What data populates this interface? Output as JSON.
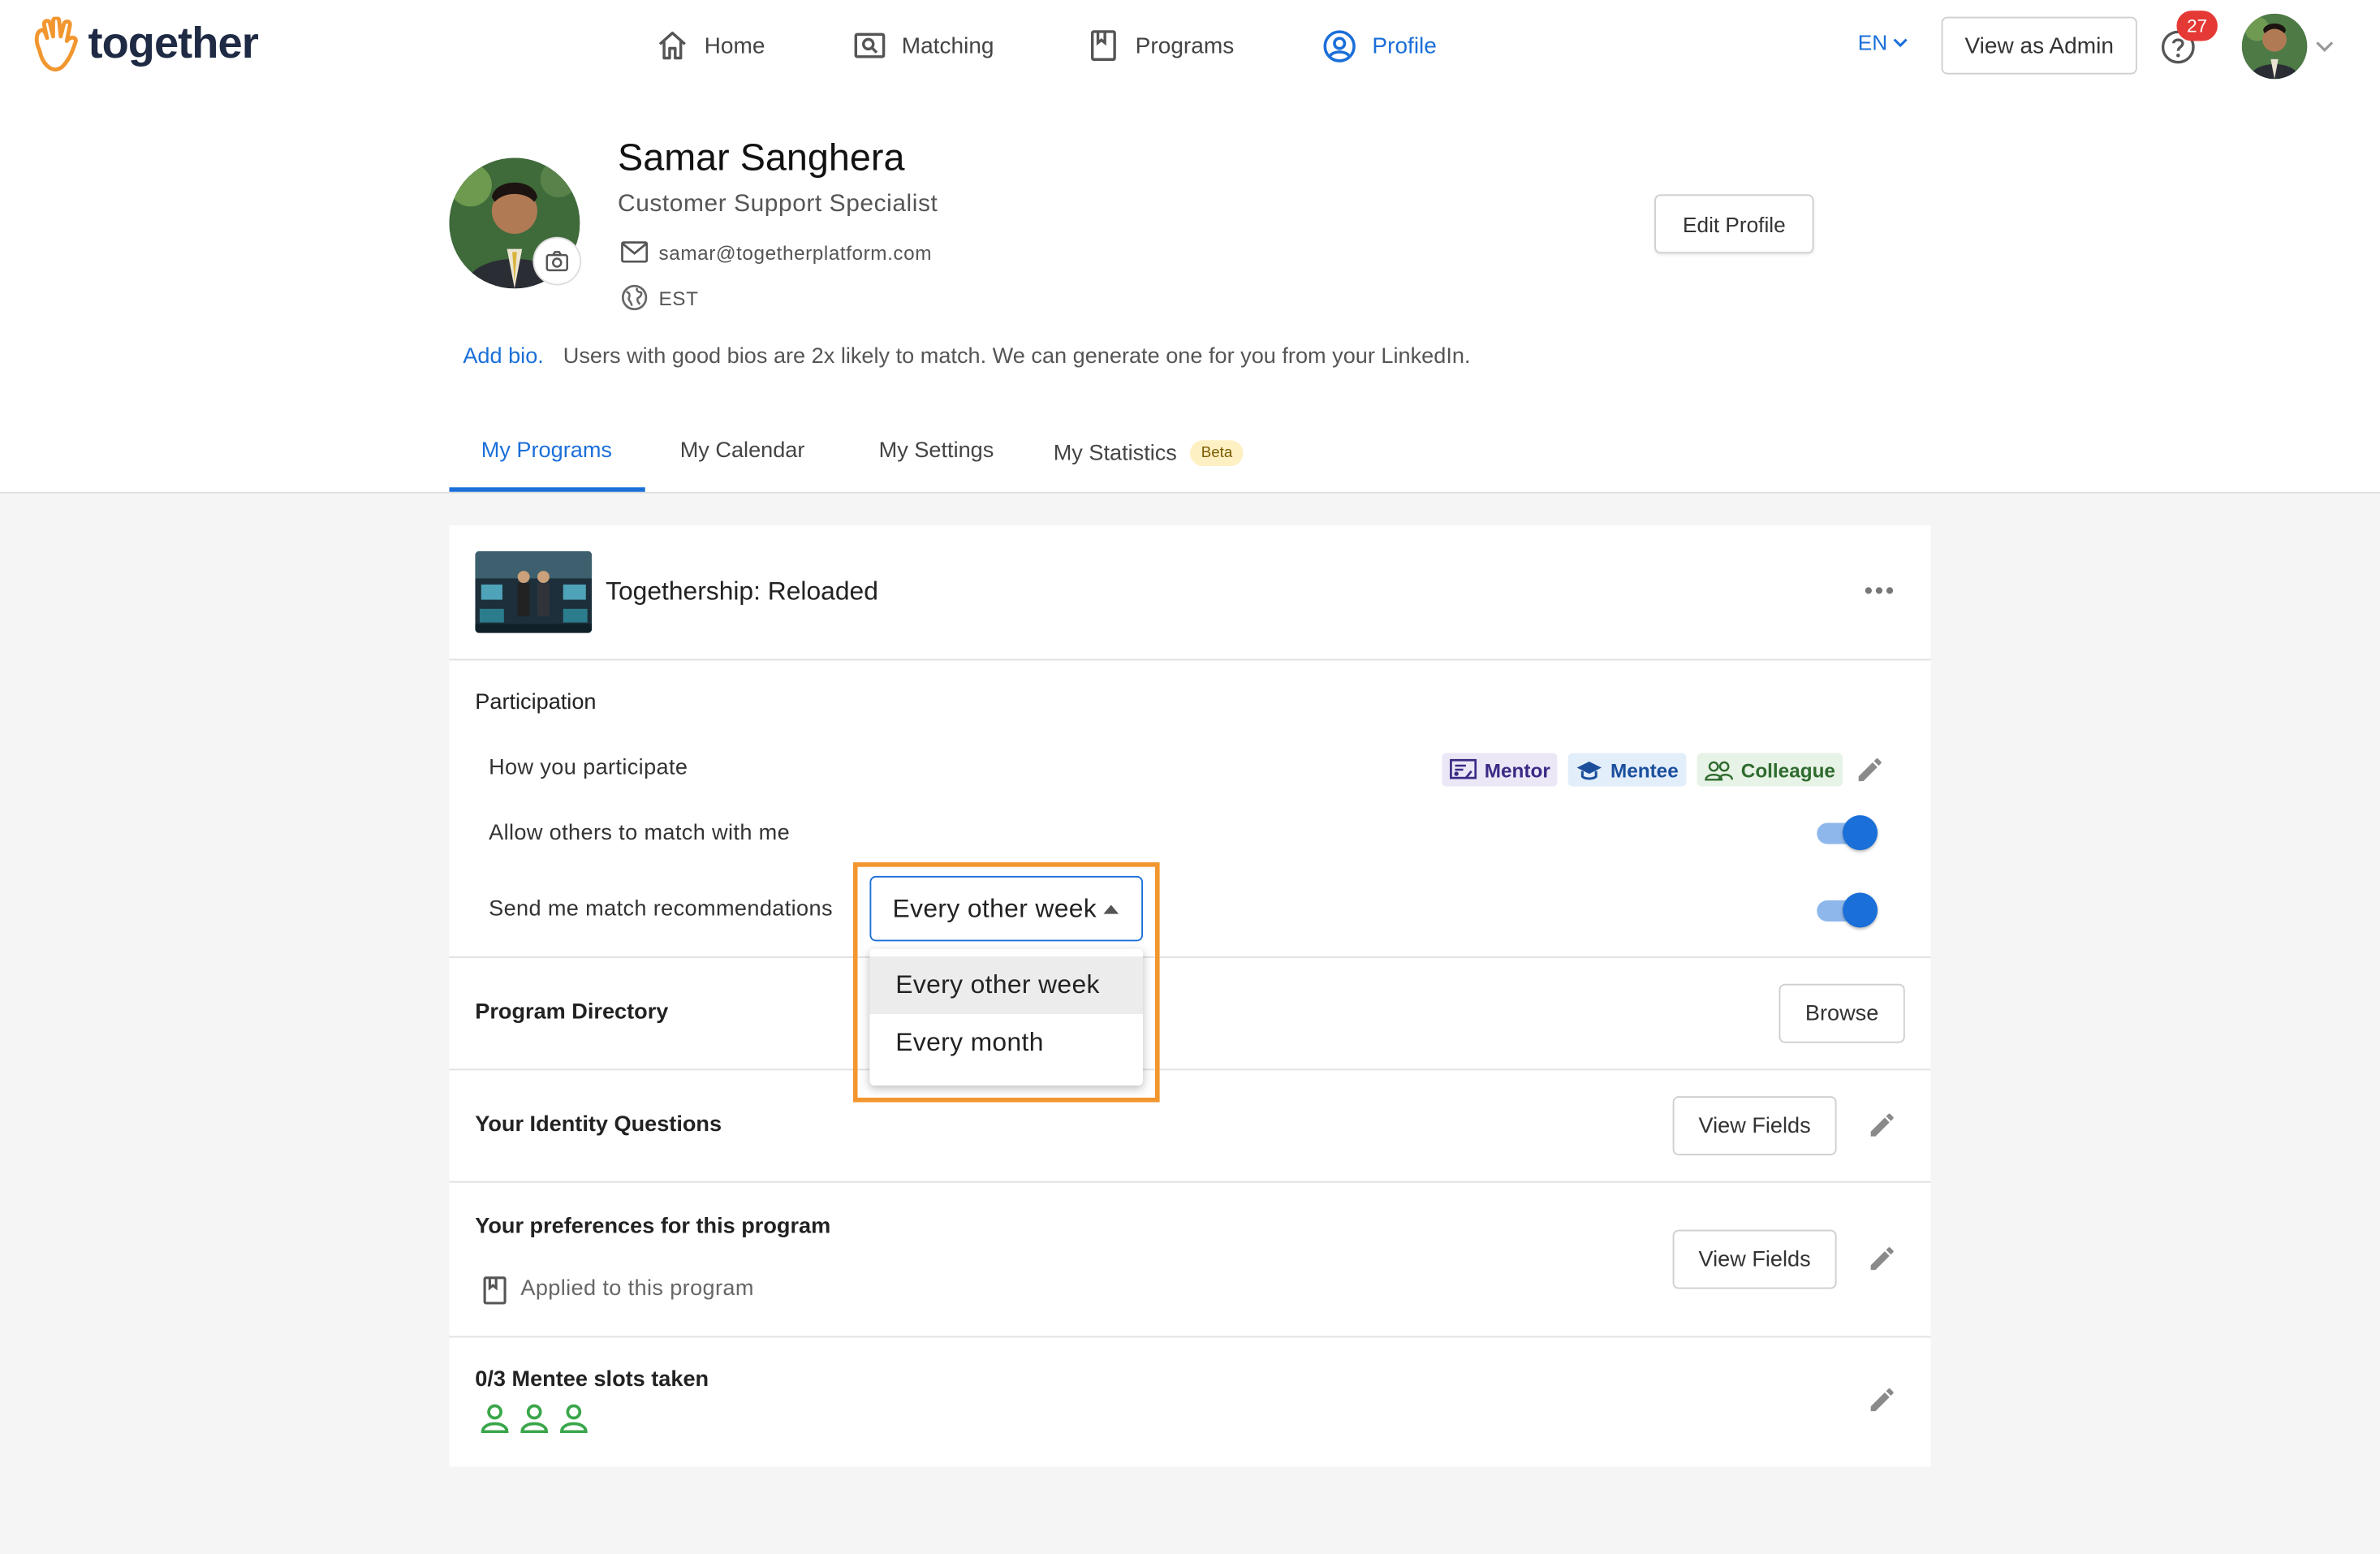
{
  "app": {
    "brand": "together"
  },
  "nav": {
    "items": [
      {
        "label": "Home",
        "icon": "home-icon"
      },
      {
        "label": "Matching",
        "icon": "matching-icon"
      },
      {
        "label": "Programs",
        "icon": "programs-icon"
      },
      {
        "label": "Profile",
        "icon": "profile-icon",
        "active": true
      }
    ],
    "language": "EN",
    "view_admin": "View as Admin",
    "notifications": "27"
  },
  "profile": {
    "name": "Samar Sanghera",
    "title": "Customer Support Specialist",
    "email": "samar@togetherplatform.com",
    "timezone": "EST",
    "edit_button": "Edit Profile",
    "bio_link": "Add bio.",
    "bio_hint": "Users with good bios are 2x likely to match. We can generate one for you from your LinkedIn."
  },
  "tabs": [
    {
      "label": "My Programs",
      "active": true
    },
    {
      "label": "My Calendar"
    },
    {
      "label": "My Settings"
    },
    {
      "label": "My Statistics",
      "badge": "Beta"
    }
  ],
  "program": {
    "name": "Togethership: Reloaded",
    "participation": {
      "heading": "Participation",
      "how_label": "How you participate",
      "roles": [
        "Mentor",
        "Mentee",
        "Colleague"
      ],
      "allow_label": "Allow others to match with me",
      "allow_on": true,
      "recommend_label": "Send me match recommendations",
      "recommend_on": true,
      "frequency": {
        "selected": "Every other week",
        "options": [
          "Every other week",
          "Every month"
        ]
      }
    },
    "directory": {
      "label": "Program Directory",
      "button": "Browse"
    },
    "identity": {
      "label": "Your Identity Questions",
      "button": "View Fields"
    },
    "preferences": {
      "label": "Your preferences for this program",
      "button": "View Fields",
      "note": "Applied to this program"
    },
    "slots": {
      "label": "0/3 Mentee slots taken",
      "taken": 0,
      "total": 3
    }
  },
  "colors": {
    "accent": "#1a6fd9",
    "highlight": "#f2962f",
    "logo": "#f2962f",
    "badge": "#e53935",
    "slot": "#3aa64a"
  }
}
